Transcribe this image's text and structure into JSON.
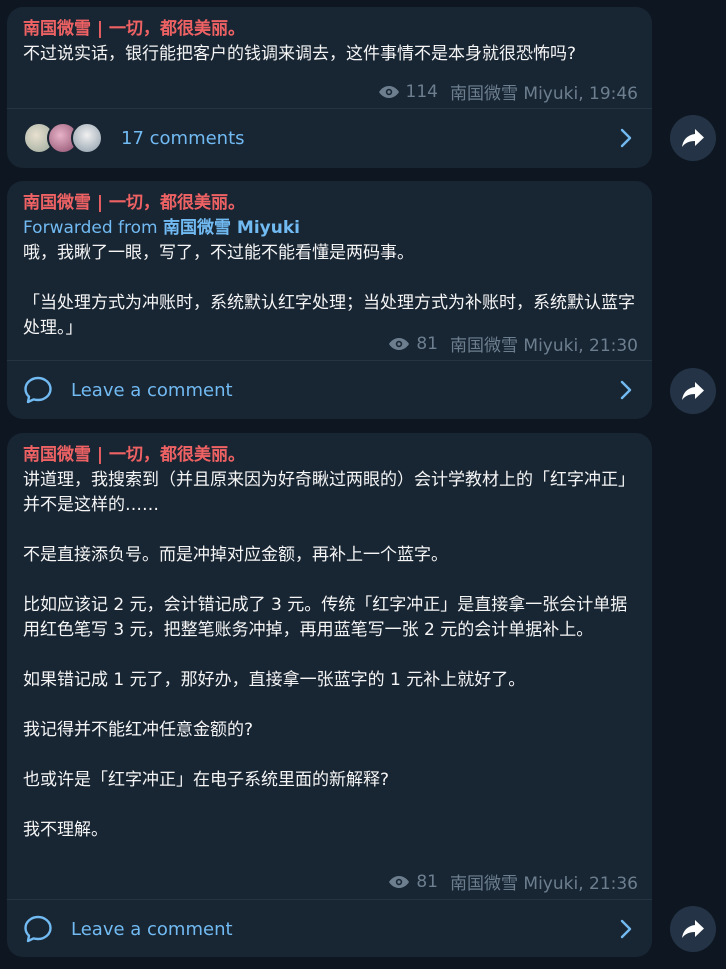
{
  "messages": [
    {
      "channel": "南国微雪 | 一切，都很美丽。",
      "text": "不过说实话，银行能把客户的钱调来调去，这件事情不是本身就很恐怖吗?",
      "views": "114",
      "signature": "南国微雪 Miyuki, 19:46",
      "footer": "17 comments"
    },
    {
      "channel": "南国微雪 | 一切，都很美丽。",
      "forward_prefix": "Forwarded from ",
      "forward_name": "南国微雪 Miyuki",
      "text": "哦，我瞅了一眼，写了，不过能不能看懂是两码事。\n\n「当处理方式为冲账时，系统默认红字处理；当处理方式为补账时，系统默认蓝字处理。」",
      "views": "81",
      "signature": "南国微雪 Miyuki, 21:30",
      "footer": "Leave a comment"
    },
    {
      "channel": "南国微雪 | 一切，都很美丽。",
      "text": "讲道理，我搜索到（并且原来因为好奇瞅过两眼的）会计学教材上的「红字冲正」并不是这样的……\n\n不是直接添负号。而是冲掉对应金额，再补上一个蓝字。\n\n比如应该记 2 元，会计错记成了 3 元。传统「红字冲正」是直接拿一张会计单据用红色笔写 3 元，把整笔账务冲掉，再用蓝笔写一张 2 元的会计单据补上。\n\n如果错记成 1 元了，那好办，直接拿一张蓝字的 1 元补上就好了。\n\n我记得并不能红冲任意金额的?\n\n也或许是「红字冲正」在电子系统里面的新解释?\n\n我不理解。",
      "views": "81",
      "signature": "南国微雪 Miyuki, 21:36",
      "footer": "Leave a comment"
    }
  ],
  "colors": {
    "background": "#0e1621",
    "bubble": "#182533",
    "channel": "#ef6264",
    "link": "#71baf2",
    "meta": "#6d7f8f"
  }
}
